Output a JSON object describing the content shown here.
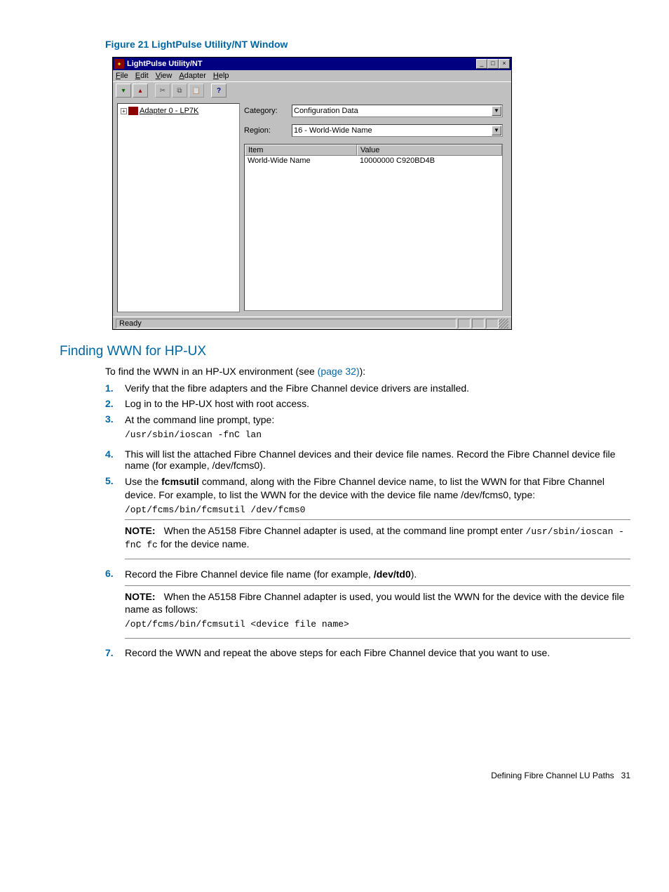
{
  "figure": {
    "caption": "Figure 21 LightPulse Utility/NT Window"
  },
  "window": {
    "title": "LightPulse Utility/NT",
    "menu": {
      "file": "File",
      "edit": "Edit",
      "view": "View",
      "adapter": "Adapter",
      "help": "Help"
    },
    "tree": {
      "item0": "Adapter 0 - LP7K"
    },
    "category_label": "Category:",
    "category_value": "Configuration Data",
    "region_label": "Region:",
    "region_value": "16 - World-Wide Name",
    "list": {
      "col_item": "Item",
      "col_value": "Value",
      "row0_item": "World-Wide Name",
      "row0_value": "10000000 C920BD4B"
    },
    "status": "Ready"
  },
  "section_heading": "Finding WWN for HP-UX",
  "intro_a": "To find the WWN in an HP-UX environment (see ",
  "intro_link": "(page 32)",
  "intro_b": "):",
  "steps": {
    "s1": "Verify that the fibre adapters and the Fibre Channel device drivers are installed.",
    "s2": "Log in to the HP-UX host with root access.",
    "s3": "At the command line prompt, type:",
    "s3_code": "/usr/sbin/ioscan -fnC lan",
    "s4": "This will list the attached Fibre Channel devices and their device file names. Record the Fibre Channel device file name (for example, /dev/fcms0).",
    "s5_a": "Use the ",
    "s5_bold": "fcmsutil",
    "s5_b": " command, along with the Fibre Channel device name, to list the WWN for that Fibre Channel device. For example, to list the WWN for the device with the device file name /dev/fcms0, type:",
    "s5_code": "/opt/fcms/bin/fcmsutil /dev/fcms0",
    "s5_note_label": "NOTE:",
    "s5_note_a": "When the A5158 Fibre Channel adapter is used, at the command line prompt enter ",
    "s5_note_code": "/usr/sbin/ioscan -fnC fc",
    "s5_note_b": " for the device name.",
    "s6_a": "Record the Fibre Channel device file name (for example, ",
    "s6_bold": "/dev/td0",
    "s6_b": ").",
    "s6_note_label": "NOTE:",
    "s6_note": "When the A5158 Fibre Channel adapter is used, you would list the WWN for the device with the device file name as follows:",
    "s6_code": "/opt/fcms/bin/fcmsutil <device file name>",
    "s7": "Record the WWN and repeat the above steps for each Fibre Channel device that you want to use."
  },
  "step_nums": {
    "n1": "1.",
    "n2": "2.",
    "n3": "3.",
    "n4": "4.",
    "n5": "5.",
    "n6": "6.",
    "n7": "7."
  },
  "footer": {
    "text": "Defining Fibre Channel LU Paths",
    "page": "31"
  }
}
